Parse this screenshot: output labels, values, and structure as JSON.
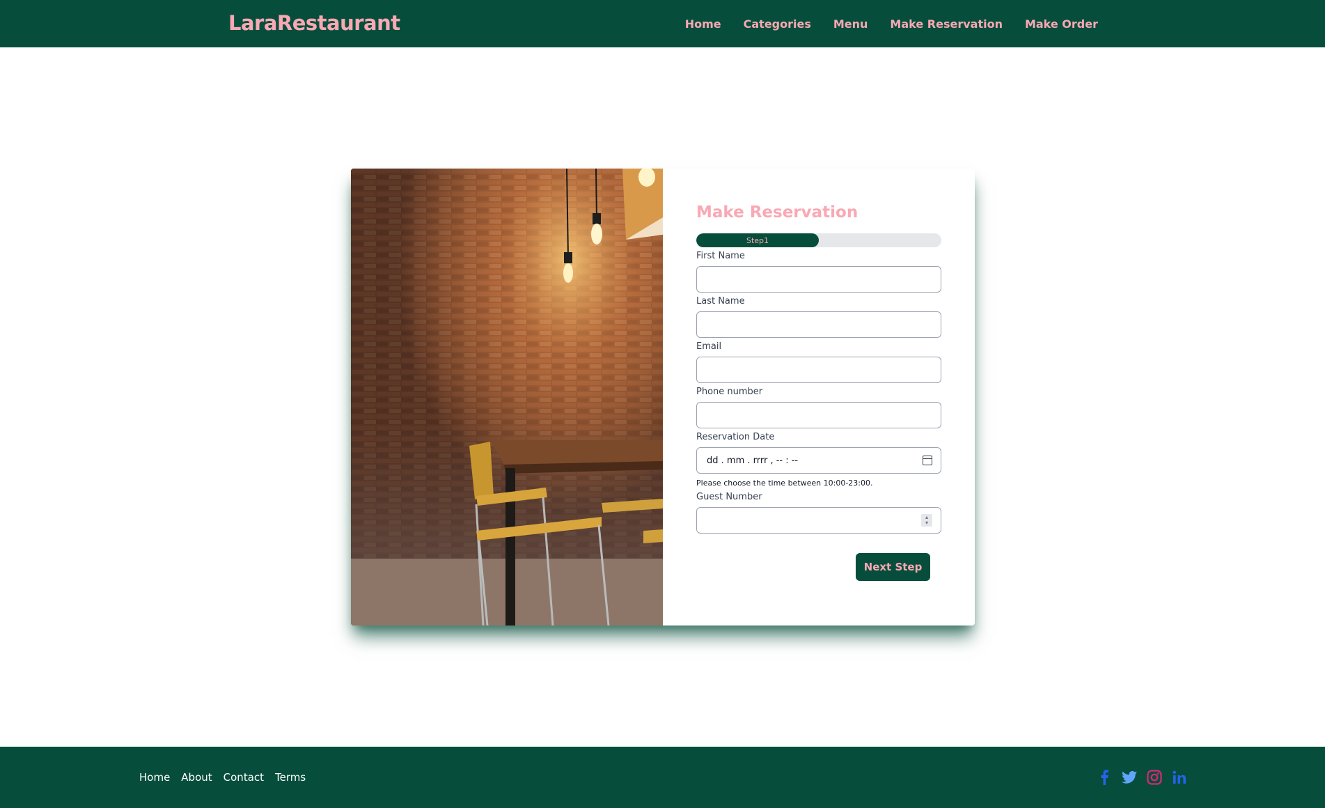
{
  "header": {
    "brand": "LaraRestaurant",
    "nav": [
      "Home",
      "Categories",
      "Menu",
      "Make Reservation",
      "Make Order"
    ]
  },
  "form": {
    "title": "Make Reservation",
    "progress": {
      "label": "Step1",
      "fraction": 0.5
    },
    "fields": {
      "first_name": "First Name",
      "last_name": "Last Name",
      "email": "Email",
      "phone": "Phone number",
      "reservation_date": "Reservation Date",
      "date_placeholder": "dd . mm . rrrr ,  -- : --",
      "time_hint": "Please choose the time between 10:00-23:00.",
      "guest_number": "Guest Number"
    },
    "next_button": "Next Step"
  },
  "footer": {
    "links": [
      "Home",
      "About",
      "Contact",
      "Terms"
    ],
    "social_icons": [
      "facebook-icon",
      "twitter-icon",
      "instagram-icon",
      "linkedin-icon"
    ]
  },
  "colors": {
    "primary": "#064e3b",
    "accent": "#f9a8b4"
  }
}
